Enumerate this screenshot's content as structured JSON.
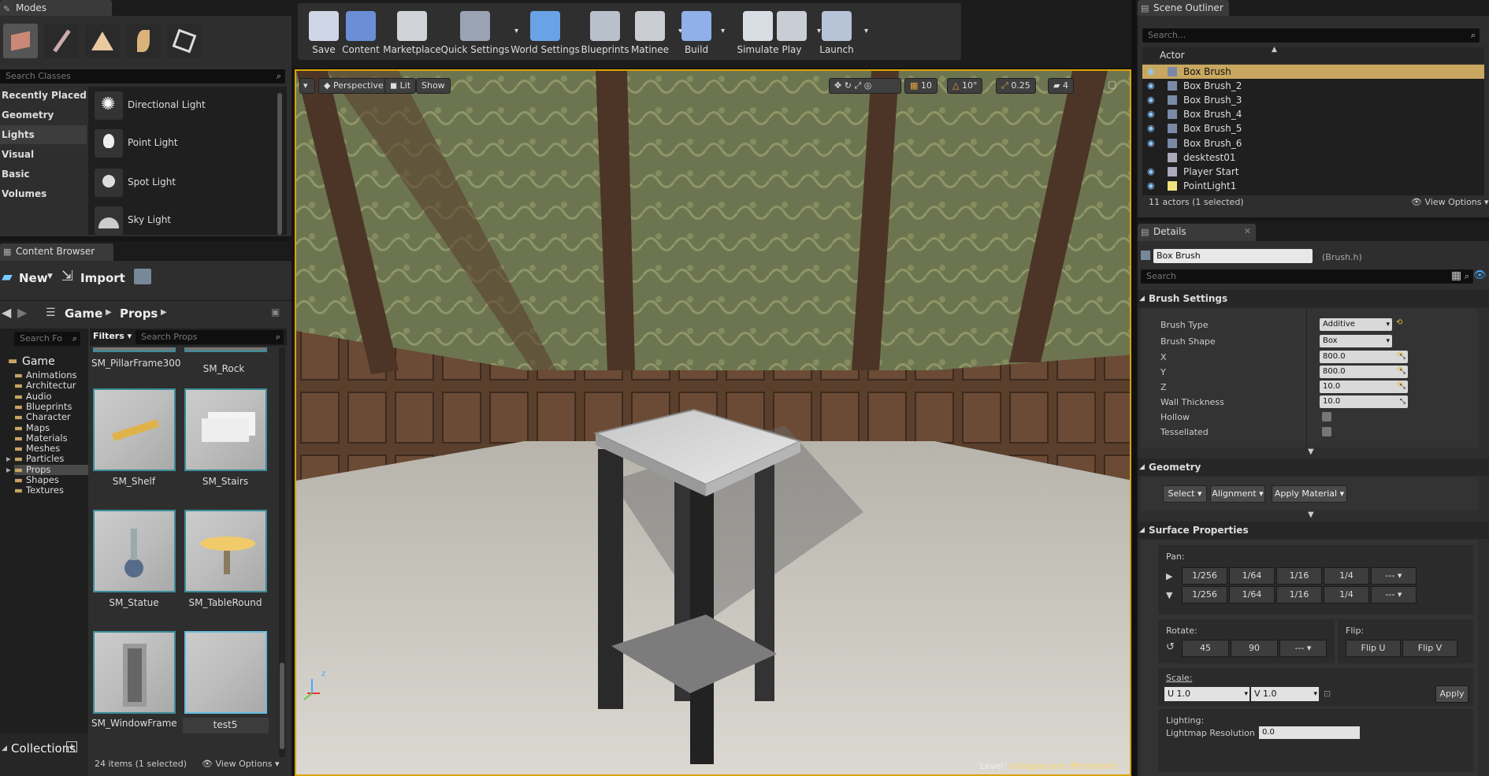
{
  "modes": {
    "tab_label": "Modes",
    "search_placeholder": "Search Classes",
    "categories": [
      "Recently Placed",
      "Geometry",
      "Lights",
      "Visual",
      "Basic",
      "Volumes"
    ],
    "items": [
      "Directional Light",
      "Point Light",
      "Spot Light",
      "Sky Light"
    ]
  },
  "content_browser": {
    "tab_label": "Content Browser",
    "new_label": "New",
    "import_label": "Import",
    "path": [
      "Game",
      "Props"
    ],
    "search_folders_placeholder": "Search Fo",
    "filters_label": "Filters",
    "search_assets_placeholder": "Search Props",
    "tree_root": "Game",
    "folders": [
      "Animations",
      "Architectur",
      "Audio",
      "Blueprints",
      "Character",
      "Maps",
      "Materials",
      "Meshes",
      "Particles",
      "Props",
      "Shapes",
      "Textures"
    ],
    "top_assets": [
      "SM_PillarFrame300",
      "SM_Rock"
    ],
    "assets": [
      "SM_Shelf",
      "SM_Stairs",
      "SM_Statue",
      "SM_TableRound",
      "SM_WindowFrame",
      "test5"
    ],
    "status": "24 items (1 selected)",
    "view_options": "View Options",
    "collections_label": "Collections"
  },
  "toolbar": {
    "buttons": [
      "Save",
      "Content",
      "Marketplace",
      "Quick Settings",
      "World Settings",
      "Blueprints",
      "Matinee",
      "Build",
      "Simulate",
      "Play",
      "Launch"
    ]
  },
  "viewport": {
    "perspective": "Perspective",
    "lit": "Lit",
    "show": "Show",
    "grid_snap": "10",
    "rot_snap": "10°",
    "scale_snap": "0.25",
    "cam_speed": "4",
    "level_label": "Level:",
    "level_name": "collegescene (Persistent)"
  },
  "outliner": {
    "tab_label": "Scene Outliner",
    "search_placeholder": "Search...",
    "column": "Actor",
    "actors": [
      "Box Brush",
      "Box Brush_2",
      "Box Brush_3",
      "Box Brush_4",
      "Box Brush_5",
      "Box Brush_6",
      "desktest01",
      "Player Start",
      "PointLight1"
    ],
    "selected_index": 0,
    "status": "11 actors (1 selected)",
    "view_options": "View Options"
  },
  "details": {
    "tab_label": "Details",
    "name": "Box Brush",
    "class_hint": "(Brush.h)",
    "search_placeholder": "Search",
    "brush_settings_title": "Brush Settings",
    "props": [
      {
        "label": "Brush Type",
        "value": "Additive"
      },
      {
        "label": "Brush Shape",
        "value": "Box"
      },
      {
        "label": "X",
        "value": "800.0"
      },
      {
        "label": "Y",
        "value": "800.0"
      },
      {
        "label": "Z",
        "value": "10.0"
      },
      {
        "label": "Wall Thickness",
        "value": "10.0"
      },
      {
        "label": "Hollow",
        "value": ""
      },
      {
        "label": "Tessellated",
        "value": ""
      }
    ],
    "geometry_title": "Geometry",
    "geometry_buttons": [
      "Select",
      "Alignment",
      "Apply Material"
    ],
    "surface_title": "Surface Properties",
    "pan_label": "Pan:",
    "pan_values": [
      "1/256",
      "1/64",
      "1/16",
      "1/4",
      "---"
    ],
    "rotate_label": "Rotate:",
    "rotate_values": [
      "45",
      "90",
      "---"
    ],
    "flip_label": "Flip:",
    "flip_u": "Flip U",
    "flip_v": "Flip V",
    "scale_label": "Scale:",
    "scale_u": "U  1.0",
    "scale_v": "V  1.0",
    "apply_label": "Apply",
    "lighting_label": "Lighting:",
    "lightmap_label": "Lightmap Resolution",
    "lightmap_value": "0.0"
  }
}
